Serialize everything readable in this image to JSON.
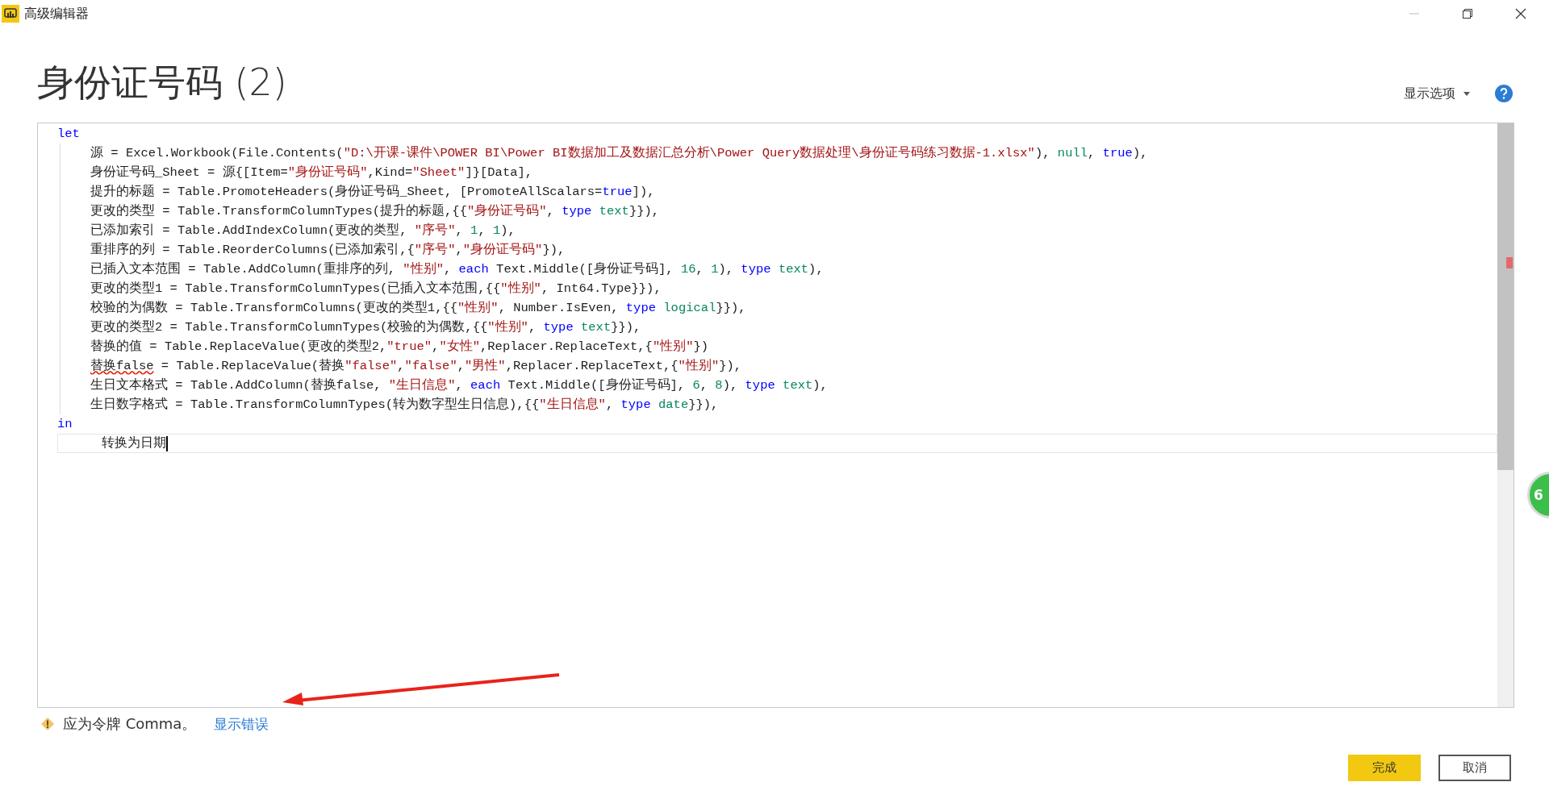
{
  "window": {
    "title": "高级编辑器"
  },
  "heading": "身份证号码 (2)",
  "display_options": "显示选项",
  "editor": {
    "lines": [
      {
        "kind": "block",
        "tokens": [
          {
            "kind": "keyword",
            "text": "let"
          }
        ]
      },
      {
        "kind": "step",
        "tokens": [
          {
            "kind": "plain",
            "text": "源 = Excel.Workbook(File.Contents("
          },
          {
            "kind": "string",
            "text": "\"D:\\开课-课件\\POWER BI\\Power BI数据加工及数据汇总分析\\Power Query数据处理\\身份证号码练习数据-1.xlsx\""
          },
          {
            "kind": "plain",
            "text": "), "
          },
          {
            "kind": "literal",
            "text": "null"
          },
          {
            "kind": "plain",
            "text": ", "
          },
          {
            "kind": "keyword",
            "text": "true"
          },
          {
            "kind": "plain",
            "text": "),"
          }
        ]
      },
      {
        "kind": "step",
        "tokens": [
          {
            "kind": "plain",
            "text": "身份证号码_Sheet = 源{[Item="
          },
          {
            "kind": "string",
            "text": "\"身份证号码\""
          },
          {
            "kind": "plain",
            "text": ",Kind="
          },
          {
            "kind": "string",
            "text": "\"Sheet\""
          },
          {
            "kind": "plain",
            "text": "]}[Data],"
          }
        ]
      },
      {
        "kind": "step",
        "tokens": [
          {
            "kind": "plain",
            "text": "提升的标题 = Table.PromoteHeaders(身份证号码_Sheet, [PromoteAllScalars="
          },
          {
            "kind": "keyword",
            "text": "true"
          },
          {
            "kind": "plain",
            "text": "]),"
          }
        ]
      },
      {
        "kind": "step",
        "tokens": [
          {
            "kind": "plain",
            "text": "更改的类型 = Table.TransformColumnTypes(提升的标题,{{"
          },
          {
            "kind": "string",
            "text": "\"身份证号码\""
          },
          {
            "kind": "plain",
            "text": ", "
          },
          {
            "kind": "keyword",
            "text": "type"
          },
          {
            "kind": "literal",
            "text": " text"
          },
          {
            "kind": "plain",
            "text": "}}),"
          }
        ]
      },
      {
        "kind": "step",
        "tokens": [
          {
            "kind": "plain",
            "text": "已添加索引 = Table.AddIndexColumn(更改的类型, "
          },
          {
            "kind": "string",
            "text": "\"序号\""
          },
          {
            "kind": "plain",
            "text": ", "
          },
          {
            "kind": "literal",
            "text": "1"
          },
          {
            "kind": "plain",
            "text": ", "
          },
          {
            "kind": "literal",
            "text": "1"
          },
          {
            "kind": "plain",
            "text": "),"
          }
        ]
      },
      {
        "kind": "step",
        "tokens": [
          {
            "kind": "plain",
            "text": "重排序的列 = Table.ReorderColumns(已添加索引,{"
          },
          {
            "kind": "string",
            "text": "\"序号\""
          },
          {
            "kind": "plain",
            "text": ","
          },
          {
            "kind": "string",
            "text": "\"身份证号码\""
          },
          {
            "kind": "plain",
            "text": "}),"
          }
        ]
      },
      {
        "kind": "step",
        "tokens": [
          {
            "kind": "plain",
            "text": "已插入文本范围 = Table.AddColumn(重排序的列, "
          },
          {
            "kind": "string",
            "text": "\"性别\""
          },
          {
            "kind": "plain",
            "text": ", "
          },
          {
            "kind": "keyword",
            "text": "each"
          },
          {
            "kind": "plain",
            "text": " Text.Middle([身份证号码], "
          },
          {
            "kind": "literal",
            "text": "16"
          },
          {
            "kind": "plain",
            "text": ", "
          },
          {
            "kind": "literal",
            "text": "1"
          },
          {
            "kind": "plain",
            "text": "), "
          },
          {
            "kind": "keyword",
            "text": "type"
          },
          {
            "kind": "literal",
            "text": " text"
          },
          {
            "kind": "plain",
            "text": "),"
          }
        ]
      },
      {
        "kind": "step",
        "tokens": [
          {
            "kind": "plain",
            "text": "更改的类型1 = Table.TransformColumnTypes(已插入文本范围,{{"
          },
          {
            "kind": "string",
            "text": "\"性别\""
          },
          {
            "kind": "plain",
            "text": ", Int64.Type}}),"
          }
        ]
      },
      {
        "kind": "step",
        "tokens": [
          {
            "kind": "plain",
            "text": "校验的为偶数 = Table.TransformColumns(更改的类型1,{{"
          },
          {
            "kind": "string",
            "text": "\"性别\""
          },
          {
            "kind": "plain",
            "text": ", Number.IsEven, "
          },
          {
            "kind": "keyword",
            "text": "type"
          },
          {
            "kind": "literal",
            "text": " logical"
          },
          {
            "kind": "plain",
            "text": "}}),"
          }
        ]
      },
      {
        "kind": "step",
        "tokens": [
          {
            "kind": "plain",
            "text": "更改的类型2 = Table.TransformColumnTypes(校验的为偶数,{{"
          },
          {
            "kind": "string",
            "text": "\"性别\""
          },
          {
            "kind": "plain",
            "text": ", "
          },
          {
            "kind": "keyword",
            "text": "type"
          },
          {
            "kind": "literal",
            "text": " text"
          },
          {
            "kind": "plain",
            "text": "}}),"
          }
        ]
      },
      {
        "kind": "step",
        "tokens": [
          {
            "kind": "plain",
            "text": "替换的值 = Table.ReplaceValue(更改的类型2,"
          },
          {
            "kind": "string",
            "text": "\"true\""
          },
          {
            "kind": "plain",
            "text": ","
          },
          {
            "kind": "string",
            "text": "\"女性\""
          },
          {
            "kind": "plain",
            "text": ",Replacer.ReplaceText,{"
          },
          {
            "kind": "string",
            "text": "\"性别\""
          },
          {
            "kind": "plain",
            "text": "})"
          }
        ]
      },
      {
        "kind": "step",
        "tokens": [
          {
            "kind": "error",
            "text": "替换false"
          },
          {
            "kind": "plain",
            "text": " = Table.ReplaceValue(替换"
          },
          {
            "kind": "string",
            "text": "\"false\""
          },
          {
            "kind": "plain",
            "text": ","
          },
          {
            "kind": "string",
            "text": "\"false\""
          },
          {
            "kind": "plain",
            "text": ","
          },
          {
            "kind": "string",
            "text": "\"男性\""
          },
          {
            "kind": "plain",
            "text": ",Replacer.ReplaceText,{"
          },
          {
            "kind": "string",
            "text": "\"性别\""
          },
          {
            "kind": "plain",
            "text": "}),"
          }
        ]
      },
      {
        "kind": "step",
        "tokens": [
          {
            "kind": "plain",
            "text": "生日文本格式 = Table.AddColumn(替换false, "
          },
          {
            "kind": "string",
            "text": "\"生日信息\""
          },
          {
            "kind": "plain",
            "text": ", "
          },
          {
            "kind": "keyword",
            "text": "each"
          },
          {
            "kind": "plain",
            "text": " Text.Middle([身份证号码], "
          },
          {
            "kind": "literal",
            "text": "6"
          },
          {
            "kind": "plain",
            "text": ", "
          },
          {
            "kind": "literal",
            "text": "8"
          },
          {
            "kind": "plain",
            "text": "), "
          },
          {
            "kind": "keyword",
            "text": "type"
          },
          {
            "kind": "literal",
            "text": " text"
          },
          {
            "kind": "plain",
            "text": "),"
          }
        ]
      },
      {
        "kind": "step",
        "tokens": [
          {
            "kind": "plain",
            "text": "生日数字格式 = Table.TransformColumnTypes(转为数字型生日信息),{{"
          },
          {
            "kind": "string",
            "text": "\"生日信息\""
          },
          {
            "kind": "plain",
            "text": ", "
          },
          {
            "kind": "keyword",
            "text": "type"
          },
          {
            "kind": "literal",
            "text": " date"
          },
          {
            "kind": "plain",
            "text": "}}),"
          }
        ]
      },
      {
        "kind": "block",
        "tokens": [
          {
            "kind": "keyword",
            "text": "in"
          }
        ]
      },
      {
        "kind": "current",
        "tokens": [
          {
            "kind": "plain",
            "text": "转换为日期"
          }
        ]
      }
    ]
  },
  "status": {
    "message": "应为令牌 Comma。",
    "link": "显示错误"
  },
  "floating_badge": "6",
  "buttons": [
    {
      "label": "完成",
      "primary": true
    },
    {
      "label": "取消",
      "primary": false
    }
  ]
}
